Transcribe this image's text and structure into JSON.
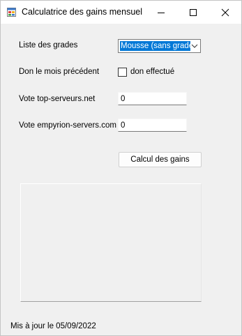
{
  "window": {
    "title": "Calculatrice des gains mensuel"
  },
  "titlebar_buttons": {
    "minimize_icon": "minimize-icon",
    "maximize_icon": "maximize-icon",
    "close_icon": "close-icon"
  },
  "form": {
    "grades_label": "Liste des grades",
    "grades_selected": "Mousse (sans grade)",
    "donation_label": "Don le mois précédent",
    "donation_checkbox_label": "don effectué",
    "donation_checked": false,
    "vote_top_label": "Vote top-serveurs.net",
    "vote_top_value": "0",
    "vote_empyrion_label": "Vote empyrion-servers.com",
    "vote_empyrion_value": "0",
    "calculate_button": "Calcul des gains",
    "result_text": ""
  },
  "footer": {
    "updated": "Mis à jour le 05/09/2022"
  },
  "colors": {
    "selection": "#0078d7",
    "window_bg": "#f0f0f0",
    "titlebar_bg": "#ffffff"
  }
}
